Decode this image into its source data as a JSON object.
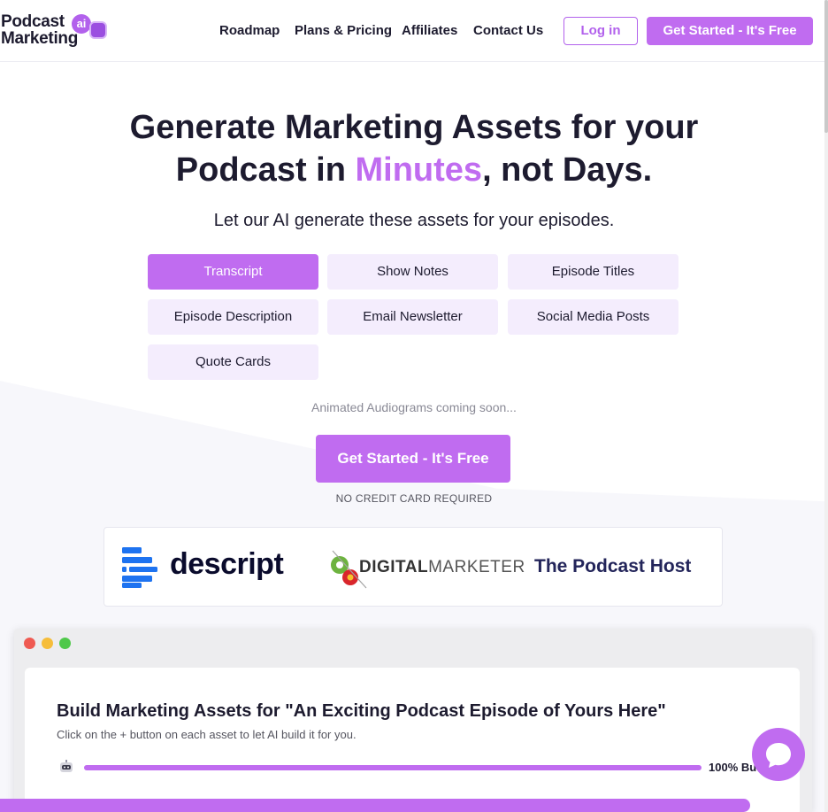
{
  "header": {
    "logo": {
      "line1": "Podcast",
      "line2": "Marketing",
      "badge": "ai",
      "icon": "robot-icon"
    },
    "nav": [
      "Roadmap",
      "Plans & Pricing",
      "Affiliates",
      "Contact Us"
    ],
    "login_label": "Log in",
    "cta_label": "Get Started - It's Free"
  },
  "hero": {
    "title_part1": "Generate Marketing Assets for your",
    "title_part2": "Podcast in ",
    "title_accent": "Minutes",
    "title_part3": ", not Days.",
    "subtitle": "Let our AI generate these assets for your episodes.",
    "assets": [
      {
        "label": "Transcript",
        "active": true
      },
      {
        "label": "Show Notes",
        "active": false
      },
      {
        "label": "Episode Titles",
        "active": false
      },
      {
        "label": "Episode Description",
        "active": false
      },
      {
        "label": "Email Newsletter",
        "active": false
      },
      {
        "label": "Social Media Posts",
        "active": false
      },
      {
        "label": "Quote Cards",
        "active": false
      }
    ],
    "coming_soon": "Animated Audiograms coming soon...",
    "cta_label": "Get Started - It's Free",
    "no_cc": "NO CREDIT CARD REQUIRED"
  },
  "partners": [
    {
      "name": "descript",
      "icon": "descript-logo-icon"
    },
    {
      "name_bold": "DIGITAL",
      "name_rest": "MARKETER",
      "icon": "digitalmarketer-logo-icon"
    },
    {
      "name": "The Podcast Host"
    }
  ],
  "preview": {
    "title": "Build Marketing Assets for \"An Exciting Podcast Episode of Yours Here\"",
    "subtitle": "Click on the + button on each asset to let AI build it for you.",
    "progress_percent": 100,
    "progress_label": "100% Bu"
  },
  "page_scroll_progress": 0.906,
  "colors": {
    "accent": "#c06cf0",
    "chip": "#f4edfd",
    "text": "#1d1b2f"
  },
  "chat": {
    "icon": "chat-bubble-icon"
  }
}
